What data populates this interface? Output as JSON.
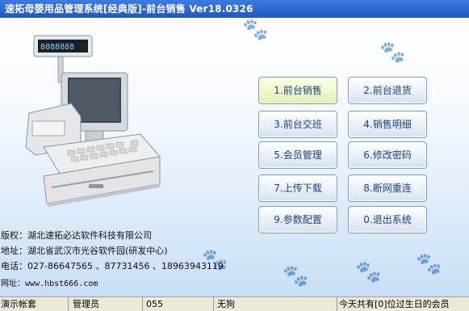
{
  "window": {
    "title": "速拓母婴用品管理系统[经典版]-前台销售 Ver18.0326"
  },
  "register_display": "8888888",
  "menu": {
    "buttons": [
      {
        "label": "1.前台销售",
        "active": true
      },
      {
        "label": "2.前台退货",
        "active": false
      },
      {
        "label": "3.前台交班",
        "active": false
      },
      {
        "label": "4.销售明细",
        "active": false
      },
      {
        "label": "5.会员管理",
        "active": false
      },
      {
        "label": "6.修改密码",
        "active": false
      },
      {
        "label": "7.上传下载",
        "active": false
      },
      {
        "label": "8.断网重连",
        "active": false
      },
      {
        "label": "9.参数配置",
        "active": false
      },
      {
        "label": "0.退出系统",
        "active": false
      }
    ]
  },
  "info": {
    "copyright": "版权：湖北速拓必达软件科技有限公司",
    "address": "地址：湖北省武汉市光谷软件园(研发中心)",
    "phone": "电话：027-86647565 、87731456 、18963943119",
    "website": "网址：www.hbst666.com"
  },
  "status": {
    "account": "演示帐套",
    "role": "管理员",
    "code": "055",
    "shift": "无狗",
    "message": "今天共有[0]位过生日的会员"
  },
  "colors": {
    "title_bar": "#1f56c4",
    "button_text": "#1d3f86",
    "active_button": "#eef7c9"
  },
  "icons": {
    "app": "app-icon",
    "watermark": "paw-icon"
  }
}
